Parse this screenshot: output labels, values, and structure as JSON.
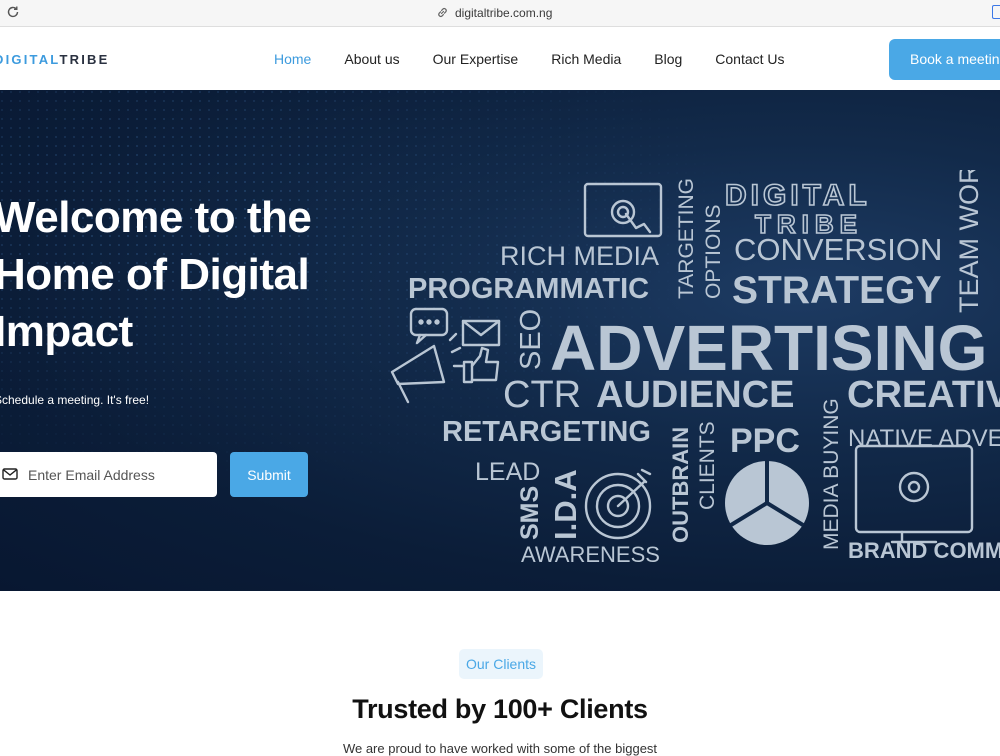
{
  "browser": {
    "url": "digitaltribe.com.ng"
  },
  "nav": {
    "logo_text": "DIGITALTRIBE",
    "links": [
      "Home",
      "About us",
      "Our Expertise",
      "Rich Media",
      "Blog",
      "Contact Us"
    ],
    "active": "Home",
    "book_label": "Book a meeting"
  },
  "hero": {
    "title_lines": [
      "Welcome to the",
      "Home of Digital",
      "Impact"
    ],
    "subtitle": "Schedule a meeting. It's free!",
    "email_placeholder": "Enter Email Address",
    "submit_label": "Submit"
  },
  "word_cloud": {
    "brand_line1": "DIGITAL",
    "brand_line2": "TRIBE",
    "words": [
      "RICH MEDIA",
      "PROGRAMMATIC",
      "TARGETING",
      "OPTIONS",
      "CONVERSION",
      "STRATEGY",
      "TEAM WORK",
      "SEO",
      "ADVERTISING",
      "CTR",
      "AUDIENCE",
      "CREATIVE",
      "MEDIA BUYING",
      "RETARGETING",
      "OUTBRAIN",
      "CLIENTS",
      "PPC",
      "NATIVE ADVERTISING",
      "LEAD",
      "SMS",
      "I.D.A",
      "AWARENESS",
      "BRAND COMMUNICATION"
    ]
  },
  "clients": {
    "pill": "Our Clients",
    "title": "Trusted by 100+ Clients",
    "subtitle": "We are proud to have worked with some of the biggest"
  },
  "colors": {
    "accent": "#4aa8e6",
    "hero_bg": "#0b1d38",
    "cloud_text": "#b9c6d4"
  }
}
